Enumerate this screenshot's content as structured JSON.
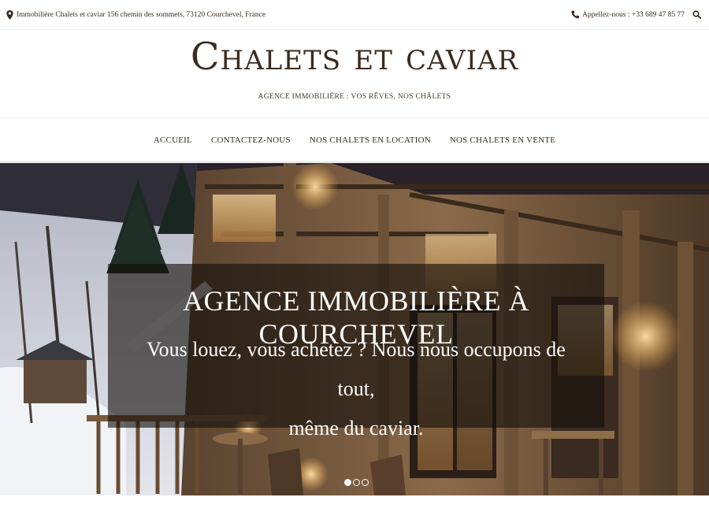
{
  "topbar": {
    "address": "Immobilière Chalets et caviar 156 chemin des sommets, 73120 Courchevel, France",
    "phone": "Appellez-nous : +33 689 47 85 77",
    "icons": {
      "address": "map-pin-icon",
      "phone": "phone-icon",
      "search": "search-icon"
    }
  },
  "brand": {
    "title": "Chalets et caviar",
    "tagline": "AGENCE IMMOBILIÈRE : VOS RÊVES, NOS CHÂLETS"
  },
  "nav": {
    "items": [
      {
        "label": "ACCUEIL"
      },
      {
        "label": "CONTACTEZ-NOUS"
      },
      {
        "label": "NOS CHALETS EN LOCATION"
      },
      {
        "label": "NOS CHALETS EN VENTE"
      }
    ]
  },
  "hero": {
    "title": "AGENCE IMMOBILIÈRE À COURCHEVEL",
    "subtitle_line1": "Vous louez, vous achetez ? Nous nous occupons de tout,",
    "subtitle_line2": "même du caviar.",
    "slides": {
      "count": 3,
      "active": 1
    }
  },
  "colors": {
    "brand_text": "#3d2b1d",
    "caption_overlay": "#140e0a",
    "border": "#ececec"
  }
}
